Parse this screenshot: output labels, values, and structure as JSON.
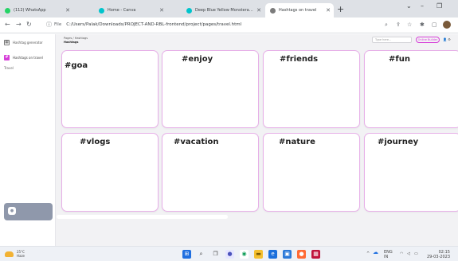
{
  "browser": {
    "tabs": [
      {
        "label": "(112) WhatsApp",
        "favicon_color": "#25d366"
      },
      {
        "label": "Home - Canva",
        "favicon_color": "#00c4cc"
      },
      {
        "label": "Deep Blue Yellow Monstera Wa...",
        "favicon_color": "#00c4cc"
      },
      {
        "label": "Hashtags on travel",
        "favicon_color": "#7b7b7b"
      }
    ],
    "new_tab": "+",
    "window_controls": {
      "minimize": "–",
      "restore": "❐",
      "more": "⌄"
    },
    "address": {
      "protocol_label": "File",
      "url": "C:/Users/Palak/Downloads/PROJECT-AND-RBL-frontend/project/pages/travel.html"
    }
  },
  "app": {
    "brand": "Hashtag generator",
    "sidebar": {
      "nav_item": "Hashtags on travel",
      "sub_item": "Travel"
    },
    "breadcrumb": {
      "path": "Pages / Hashtags",
      "title": "Hashtags"
    },
    "search_placeholder": "Type here...",
    "top_pill": "Online Builder",
    "hashtags": [
      "#goa",
      "#enjoy",
      "#friends",
      "#fun",
      "#vlogs",
      "#vacation",
      "#nature",
      "#journey"
    ]
  },
  "taskbar": {
    "weather": {
      "temp": "25°C",
      "status": "Haze"
    },
    "tray": {
      "lang": "ENG",
      "region": "IN",
      "time": "02:15",
      "date": "29-03-2023"
    }
  },
  "colors": {
    "accent": "#d63fd8",
    "card_border": "#e7b0e8",
    "app_bg": "#f2f2f4"
  }
}
